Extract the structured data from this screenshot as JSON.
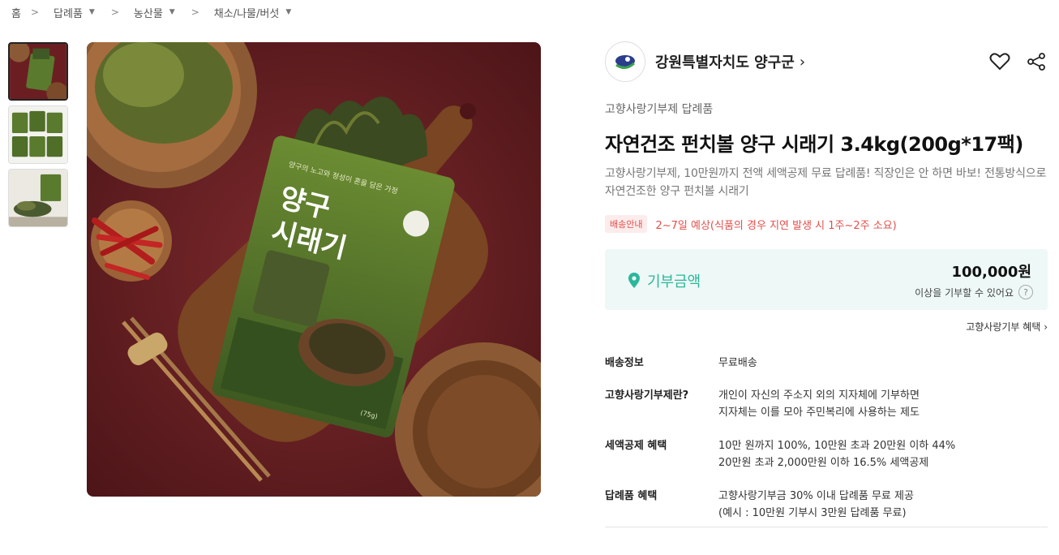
{
  "breadcrumb": {
    "home": "홈",
    "level1": "답례품",
    "level2": "농산물",
    "level3": "채소/나물/버섯"
  },
  "seller": {
    "name": "강원특별자치도 양구군"
  },
  "product": {
    "category": "고향사랑기부제 답례품",
    "title": "자연건조 펀치볼 양구 시래기 3.4kg(200g*17팩)",
    "description": "고향사랑기부제, 10만원까지 전액 세액공제 무료 답례품! 직장인은 안 하면 바보! 전통방식으로 자연건조한 양구 펀치볼 시래기"
  },
  "package": {
    "tagline": "양구의 노고와 정성이 혼을 담은 가정",
    "name_line1": "양구",
    "name_line2": "시래기",
    "weight": "(75g)"
  },
  "shipping": {
    "badge": "배송안내",
    "text": "2~7일 예상(식품의 경우 지연 발생 시 1주~2주 소요)"
  },
  "donation": {
    "label": "기부금액",
    "amount": "100,000원",
    "note": "이상을 기부할 수 있어요",
    "help": "?"
  },
  "benefit_link": "고향사랑기부 혜택",
  "info": [
    {
      "key": "배송정보",
      "lines": [
        "무료배송"
      ]
    },
    {
      "key": "고향사랑기부제란?",
      "lines": [
        "개인이 자신의 주소지 외의 지자체에 기부하면",
        "지자체는 이를 모아 주민복리에 사용하는 제도"
      ]
    },
    {
      "key": "세액공제 혜택",
      "lines": [
        "10만 원까지 100%, 10만원 초과 20만원 이하 44%",
        "20만원 초과 2,000만원 이하 16.5% 세액공제"
      ]
    },
    {
      "key": "답례품 혜택",
      "lines": [
        "고향사랑기부금 30% 이내 답례품 무료 제공",
        "(예시 : 10만원 기부시 3만원 답례품 무료)"
      ]
    }
  ],
  "icons": {
    "heart": "heart-icon",
    "share": "share-icon",
    "pin": "location-pin-icon"
  },
  "colors": {
    "accent": "#2bb79c",
    "shipping": "#e2504c",
    "background_panel": "#eef8f6",
    "image_bg": "#6b1e22",
    "package_green": "#5a7a2e"
  }
}
